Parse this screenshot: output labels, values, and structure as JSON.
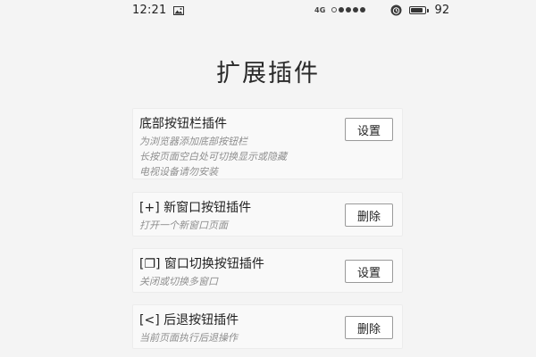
{
  "status_bar": {
    "time": "12:21",
    "network": "4G",
    "battery_level": 0.92,
    "battery_percent": "92",
    "icons": [
      "image-icon",
      "signal-icon",
      "alarm-icon",
      "battery-icon"
    ]
  },
  "page": {
    "title": "扩展插件"
  },
  "plugins": [
    {
      "title": "底部按钮栏插件",
      "description": [
        "为浏览器添加底部按钮栏",
        "长按页面空白处可切换显示或隐藏",
        "电视设备请勿安装"
      ],
      "button": "设置"
    },
    {
      "title": "[+] 新窗口按钮插件",
      "description": [
        "打开一个新窗口页面"
      ],
      "button": "删除"
    },
    {
      "title": "[❐] 窗口切换按钮插件",
      "description": [
        "关闭或切换多窗口"
      ],
      "button": "设置"
    },
    {
      "title": "[<] 后退按钮插件",
      "description": [
        "当前页面执行后退操作"
      ],
      "button": "删除"
    }
  ]
}
